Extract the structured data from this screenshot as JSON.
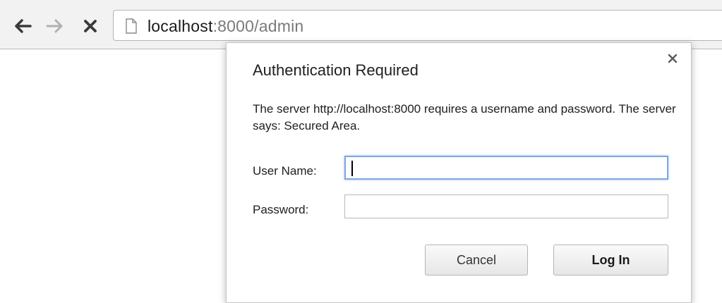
{
  "browser": {
    "url_host": "localhost",
    "url_rest": ":8000/admin",
    "icons": {
      "back": "arrow-left-icon",
      "forward": "arrow-right-icon",
      "stop": "stop-x-icon",
      "page": "page-document-icon"
    }
  },
  "dialog": {
    "title": "Authentication Required",
    "message": "The server http://localhost:8000 requires a username and password. The server says: Secured Area.",
    "username_label": "User Name:",
    "username_value": "",
    "password_label": "Password:",
    "password_value": "",
    "cancel_label": "Cancel",
    "login_label": "Log In",
    "close_icon": "close-icon"
  },
  "colors": {
    "focus_border": "#7fa8e0",
    "toolbar_bg": "#f2f2f2"
  }
}
